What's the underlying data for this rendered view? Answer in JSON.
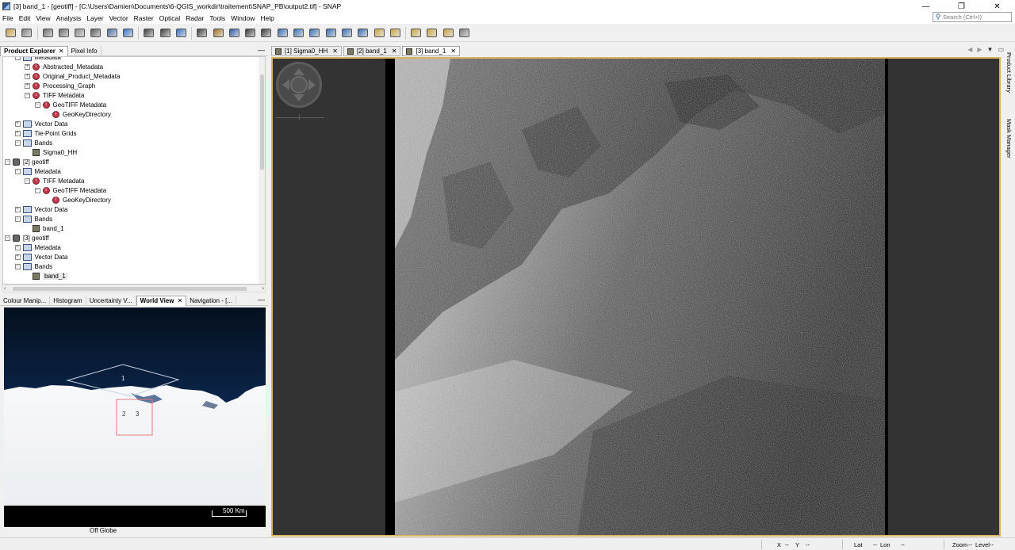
{
  "window": {
    "title": "[3] band_1 - [geotiff] - [C:\\Users\\Damien\\Documents\\6-QGIS_workdir\\traitement\\SNAP_PB\\output2.tif] - SNAP",
    "minimize": "—",
    "restore": "❐",
    "close": "✕"
  },
  "menu": [
    "File",
    "Edit",
    "View",
    "Analysis",
    "Layer",
    "Vector",
    "Raster",
    "Optical",
    "Radar",
    "Tools",
    "Window",
    "Help"
  ],
  "search": {
    "placeholder": "Search (Ctrl+I)"
  },
  "toolbar_icons": [
    "open-product-icon",
    "save-product-icon",
    "sep",
    "band-maths-icon",
    "statistics-icon",
    "grid-icon",
    "pin-icon",
    "gcp-manager-icon",
    "world-view-icon",
    "sep",
    "graph-builder-icon",
    "batch-processing-icon",
    "time-series-icon",
    "sep",
    "select-tool-icon",
    "pan-tool-icon",
    "zoom-tool-icon",
    "zoom-in-tool-icon",
    "gcp-tool-icon",
    "line-tool-icon",
    "polyline-tool-icon",
    "rectangle-tool-icon",
    "polygon-tool-icon",
    "ellipse-tool-icon",
    "range-finder-icon",
    "layer-editor-icon",
    "magic-wand-icon",
    "sep",
    "tile-horizontal-icon",
    "tile-vertical-icon",
    "tile-grid-icon",
    "tile-evenly-icon"
  ],
  "left_panel": {
    "tabs": [
      {
        "label": "Product Explorer",
        "active": true,
        "closable": true
      },
      {
        "label": "Pixel Info",
        "active": false,
        "closable": false
      }
    ],
    "minimize": "—",
    "tree": [
      {
        "label": "Metadata",
        "type": "folder",
        "expand": "-",
        "indent": 1
      },
      {
        "label": "Abstracted_Metadata",
        "type": "meta",
        "expand": "+",
        "indent": 2
      },
      {
        "label": "Original_Product_Metadata",
        "type": "meta",
        "expand": "+",
        "indent": 2
      },
      {
        "label": "Processing_Graph",
        "type": "meta",
        "expand": "+",
        "indent": 2
      },
      {
        "label": "TIFF Metadata",
        "type": "meta",
        "expand": "-",
        "indent": 2
      },
      {
        "label": "GeoTIFF Metadata",
        "type": "meta",
        "expand": "-",
        "indent": 3
      },
      {
        "label": "GeoKeyDirectory",
        "type": "meta",
        "expand": "",
        "indent": 4
      },
      {
        "label": "Vector Data",
        "type": "folder",
        "expand": "+",
        "indent": 1
      },
      {
        "label": "Tie-Point Grids",
        "type": "folder",
        "expand": "+",
        "indent": 1
      },
      {
        "label": "Bands",
        "type": "folder",
        "expand": "-",
        "indent": 1
      },
      {
        "label": "Sigma0_HH",
        "type": "band",
        "expand": "",
        "indent": 2
      },
      {
        "label": "[2] geotiff",
        "type": "product",
        "expand": "-",
        "indent": 0
      },
      {
        "label": "Metadata",
        "type": "folder",
        "expand": "-",
        "indent": 1
      },
      {
        "label": "TIFF Metadata",
        "type": "meta",
        "expand": "-",
        "indent": 2
      },
      {
        "label": "GeoTIFF Metadata",
        "type": "meta",
        "expand": "-",
        "indent": 3
      },
      {
        "label": "GeoKeyDirectory",
        "type": "meta",
        "expand": "",
        "indent": 4
      },
      {
        "label": "Vector Data",
        "type": "folder",
        "expand": "+",
        "indent": 1
      },
      {
        "label": "Bands",
        "type": "folder",
        "expand": "-",
        "indent": 1
      },
      {
        "label": "band_1",
        "type": "band",
        "expand": "",
        "indent": 2
      },
      {
        "label": "[3] geotiff",
        "type": "product",
        "expand": "-",
        "indent": 0
      },
      {
        "label": "Metadata",
        "type": "folder",
        "expand": "+",
        "indent": 1
      },
      {
        "label": "Vector Data",
        "type": "folder",
        "expand": "+",
        "indent": 1
      },
      {
        "label": "Bands",
        "type": "folder",
        "expand": "-",
        "indent": 1
      },
      {
        "label": "band_1",
        "type": "band",
        "expand": "",
        "indent": 2,
        "selected": true
      }
    ]
  },
  "bottom_panel": {
    "tabs": [
      {
        "label": "Colour Manip...",
        "active": false,
        "closable": false
      },
      {
        "label": "Histogram",
        "active": false,
        "closable": false
      },
      {
        "label": "Uncertainty V...",
        "active": false,
        "closable": false
      },
      {
        "label": "World View",
        "active": true,
        "closable": true
      },
      {
        "label": "Navigation - [...",
        "active": false,
        "closable": false
      }
    ],
    "minimize": "—",
    "world_view": {
      "product_labels": [
        "1",
        "2",
        "3"
      ],
      "scale_label": "500 Km",
      "status": "Off Globe"
    }
  },
  "view_tabs": [
    {
      "label": "[1] Sigma0_HH",
      "active": false
    },
    {
      "label": "[2] band_1",
      "active": false
    },
    {
      "label": "[3] band_1",
      "active": true
    }
  ],
  "view_tabs_nav": {
    "left": "◀",
    "right": "▶",
    "list": "▼",
    "max": "▭"
  },
  "right_sidebar": [
    "Product Library",
    "Mask Manager"
  ],
  "statusbar": {
    "x": "X",
    "x_val": "--",
    "y": "Y",
    "y_val": "--",
    "lat": "Lat",
    "lat_val": "--",
    "lon": "Lon",
    "lon_val": "--",
    "zoom": "Zoom",
    "zoom_val": "--",
    "level": "Level",
    "level_val": "--"
  },
  "colors": {
    "accent_border": "#d6b55e",
    "world_ocean": "#0e2a55",
    "ice": "#f2f4f6"
  }
}
